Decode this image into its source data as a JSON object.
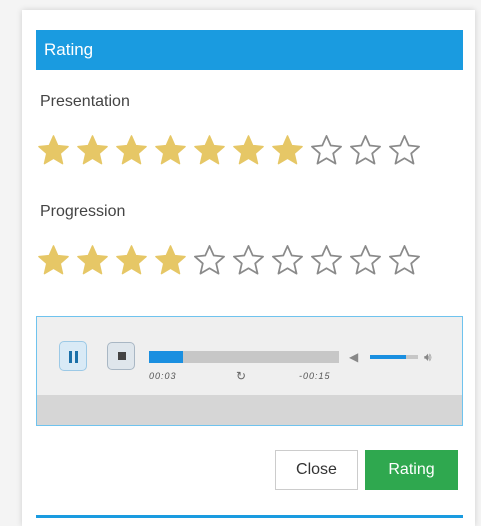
{
  "header": {
    "title": "Rating"
  },
  "ratings": [
    {
      "label": "Presentation",
      "value": 7,
      "max": 10
    },
    {
      "label": "Progression",
      "value": 4,
      "max": 10
    }
  ],
  "player": {
    "state": "playing",
    "elapsed": "00:03",
    "remaining": "-00:15",
    "progress": 0.18,
    "volume": 0.75,
    "icons": [
      "pause-icon",
      "stop-icon",
      "loop-icon",
      "volume-low-icon",
      "volume-high-icon"
    ]
  },
  "buttons": {
    "close": "Close",
    "rating": "Rating"
  },
  "colors": {
    "accent": "#1a9be0",
    "star_filled": "#e6c766",
    "star_empty": "#8a8a8a",
    "rating_button": "#2fa84f"
  }
}
